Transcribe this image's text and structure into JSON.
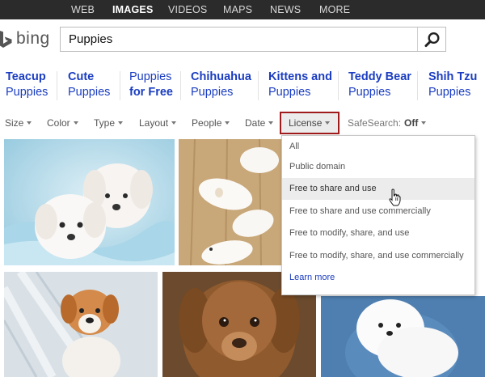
{
  "nav": {
    "tabs": [
      "WEB",
      "IMAGES",
      "VIDEOS",
      "MAPS",
      "NEWS",
      "MORE"
    ],
    "active": "IMAGES"
  },
  "logo": {
    "text": "bing"
  },
  "search": {
    "value": "Puppies"
  },
  "related": [
    {
      "bold": "Teacup",
      "normal": "Puppies"
    },
    {
      "bold": "Cute",
      "normal": "Puppies"
    },
    {
      "bold": "",
      "normal": "Puppies",
      "extra": "for Free"
    },
    {
      "bold": "Chihuahua",
      "normal": "Puppies"
    },
    {
      "bold": "Kittens and",
      "normal": "Puppies"
    },
    {
      "bold": "Teddy Bear",
      "normal": "Puppies"
    },
    {
      "bold": "Shih Tzu",
      "normal": "Puppies"
    }
  ],
  "filters": {
    "size": "Size",
    "color": "Color",
    "type": "Type",
    "layout": "Layout",
    "people": "People",
    "date": "Date",
    "license": "License",
    "safesearch_label": "SafeSearch:",
    "safesearch_value": "Off"
  },
  "license_menu": {
    "options": [
      "All",
      "Public domain",
      "Free to share and use",
      "Free to share and use commercially",
      "Free to modify, share, and use",
      "Free to modify, share, and use commercially"
    ],
    "hovered": "Free to share and use",
    "learn_more": "Learn more"
  },
  "colors": {
    "nav_bg": "#2b2b2b",
    "link_blue": "#1a3dc1",
    "license_border": "#a01b1b"
  },
  "icons": [
    "bing-logo-icon",
    "search-icon",
    "caret-down-icon",
    "hand-pointer-icon"
  ]
}
